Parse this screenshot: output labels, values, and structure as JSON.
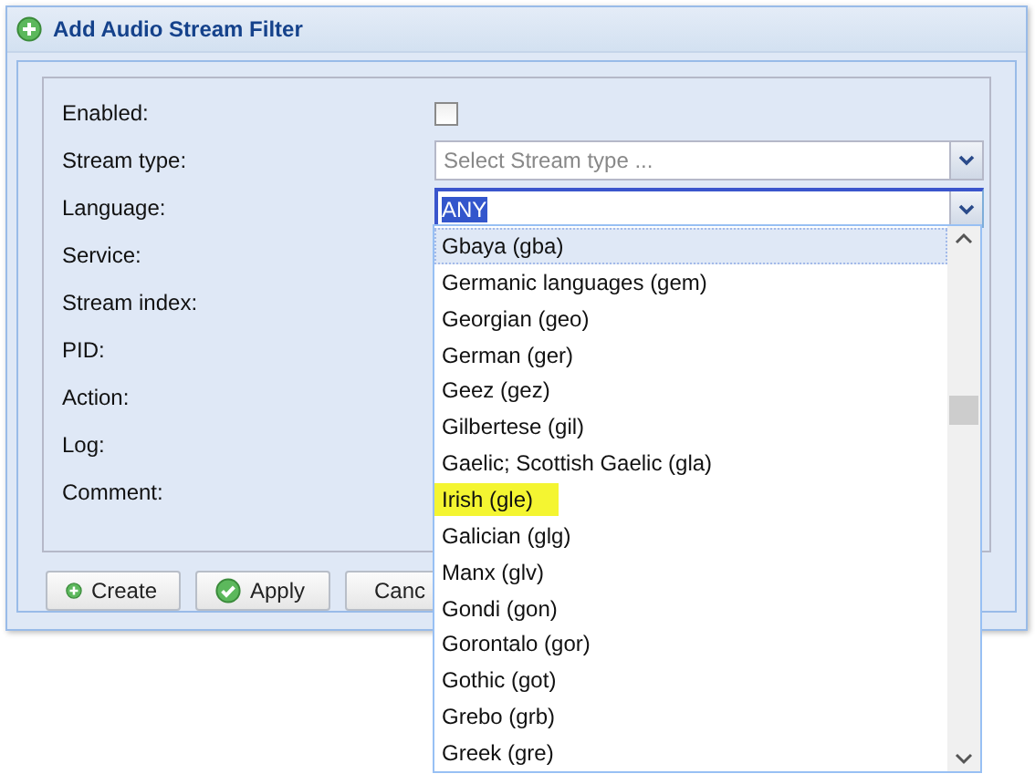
{
  "window": {
    "title": "Add Audio Stream Filter"
  },
  "form": {
    "fields": [
      {
        "label": "Enabled:",
        "kind": "checkbox",
        "checked": false
      },
      {
        "label": "Stream type:",
        "kind": "combo",
        "placeholder": "Select Stream type ..."
      },
      {
        "label": "Language:",
        "kind": "combo",
        "value": "ANY",
        "focused": true
      },
      {
        "label": "Service:",
        "kind": "hidden"
      },
      {
        "label": "Stream index:",
        "kind": "hidden"
      },
      {
        "label": "PID:",
        "kind": "hidden"
      },
      {
        "label": "Action:",
        "kind": "hidden"
      },
      {
        "label": "Log:",
        "kind": "hidden"
      },
      {
        "label": "Comment:",
        "kind": "hidden"
      }
    ]
  },
  "buttons": [
    {
      "label": "Create",
      "kind": "add"
    },
    {
      "label": "Apply",
      "kind": "apply"
    },
    {
      "label": "Canc",
      "kind": "cancel"
    }
  ],
  "dropdown": {
    "items": [
      {
        "label": "Gbaya (gba)",
        "hovered": true,
        "highlighted": false
      },
      {
        "label": "Germanic languages (gem)",
        "hovered": false,
        "highlighted": false
      },
      {
        "label": "Georgian (geo)",
        "hovered": false,
        "highlighted": false
      },
      {
        "label": "German (ger)",
        "hovered": false,
        "highlighted": false
      },
      {
        "label": "Geez (gez)",
        "hovered": false,
        "highlighted": false
      },
      {
        "label": "Gilbertese (gil)",
        "hovered": false,
        "highlighted": false
      },
      {
        "label": "Gaelic; Scottish Gaelic (gla)",
        "hovered": false,
        "highlighted": false
      },
      {
        "label": "Irish (gle)",
        "hovered": false,
        "highlighted": true
      },
      {
        "label": "Galician (glg)",
        "hovered": false,
        "highlighted": false
      },
      {
        "label": "Manx (glv)",
        "hovered": false,
        "highlighted": false
      },
      {
        "label": "Gondi (gon)",
        "hovered": false,
        "highlighted": false
      },
      {
        "label": "Gorontalo (gor)",
        "hovered": false,
        "highlighted": false
      },
      {
        "label": "Gothic (got)",
        "hovered": false,
        "highlighted": false
      },
      {
        "label": "Grebo (grb)",
        "hovered": false,
        "highlighted": false
      },
      {
        "label": "Greek (gre)",
        "hovered": false,
        "highlighted": false
      }
    ]
  }
}
